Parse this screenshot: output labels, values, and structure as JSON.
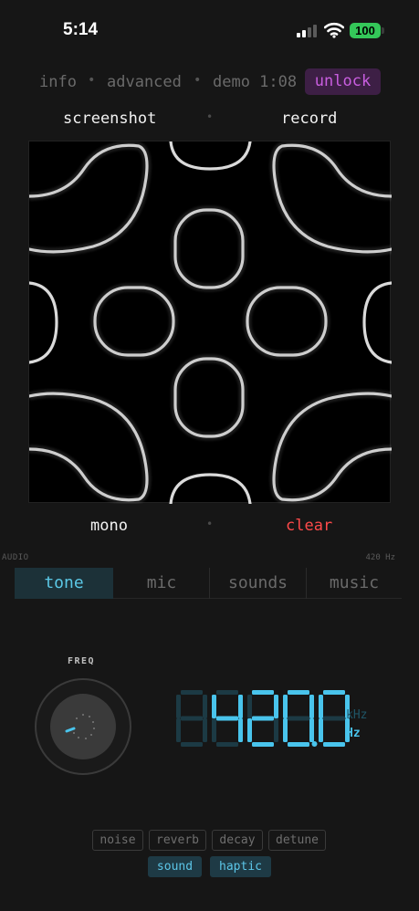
{
  "status": {
    "time": "5:14",
    "battery": "100"
  },
  "nav": {
    "info": "info",
    "advanced": "advanced",
    "demo": "demo 1:08",
    "separator": "•",
    "unlock": "unlock"
  },
  "actions": {
    "screenshot": "screenshot",
    "record": "record",
    "separator": "•"
  },
  "canvas_actions": {
    "mono": "mono",
    "clear": "clear",
    "separator": "•"
  },
  "audio": {
    "section_label": "AUDIO",
    "frequency_label": "420 Hz",
    "tabs": [
      {
        "label": "tone",
        "active": true
      },
      {
        "label": "mic",
        "active": false
      },
      {
        "label": "sounds",
        "active": false
      },
      {
        "label": "music",
        "active": false
      }
    ]
  },
  "freq": {
    "label": "FREQ",
    "display_value": "420.0",
    "unit_khz": "kHz",
    "unit_hz": "Hz"
  },
  "toggles": [
    {
      "label": "noise",
      "on": false
    },
    {
      "label": "reverb",
      "on": false
    },
    {
      "label": "decay",
      "on": false
    },
    {
      "label": "detune",
      "on": false
    },
    {
      "label": "sound",
      "on": true
    },
    {
      "label": "haptic",
      "on": true
    }
  ],
  "colors": {
    "accent": "#49c4ec",
    "unlock": "#c95ee0",
    "clear": "#ff4a4a",
    "battery": "#34c759"
  }
}
